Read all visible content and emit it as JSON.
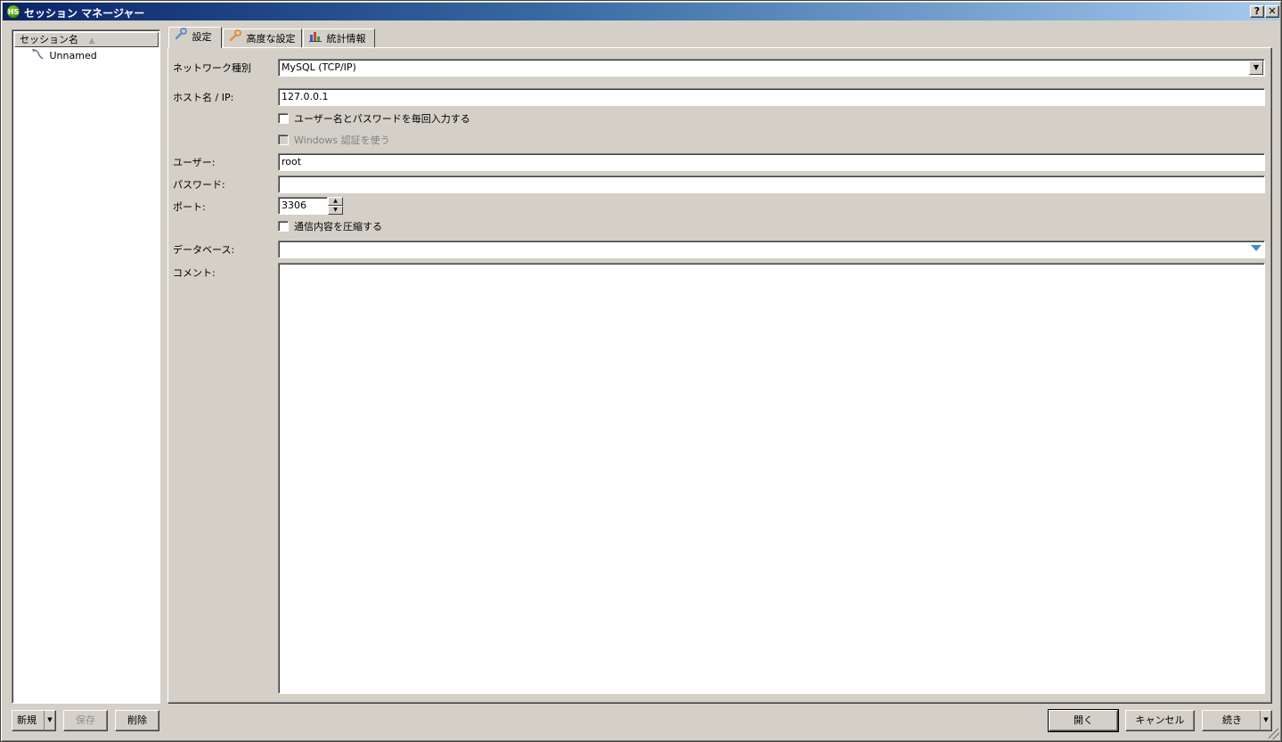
{
  "window": {
    "title": "セッション マネージャー",
    "icon_text": "HS",
    "help_label": "?",
    "close_label": "✕"
  },
  "session_list": {
    "header": "セッション名",
    "sort_indicator": "▲",
    "items": [
      {
        "label": "Unnamed",
        "icon": "database-icon"
      }
    ]
  },
  "tabs": [
    {
      "label": "設定",
      "icon": "wrench-icon",
      "active": true
    },
    {
      "label": "高度な設定",
      "icon": "wrench-orange-icon",
      "active": false
    },
    {
      "label": "統計情報",
      "icon": "bar-chart-icon",
      "active": false
    }
  ],
  "settings": {
    "network_type_label": "ネットワーク種別",
    "network_type_value": "MySQL (TCP/IP)",
    "host_label": "ホスト名 / IP:",
    "host_value": "127.0.0.1",
    "prompt_login_label": "ユーザー名とパスワードを毎回入力する",
    "windows_auth_label": "Windows 認証を使う",
    "user_label": "ユーザー:",
    "user_value": "root",
    "password_label": "パスワード:",
    "password_value": "",
    "port_label": "ポート:",
    "port_value": "3306",
    "compress_label": "通信内容を圧縮する",
    "database_label": "データベース:",
    "database_value": "",
    "comment_label": "コメント:",
    "comment_value": ""
  },
  "buttons": {
    "new": "新規",
    "save": "保存",
    "delete": "削除",
    "open": "開く",
    "cancel": "キャンセル",
    "more": "続き"
  }
}
